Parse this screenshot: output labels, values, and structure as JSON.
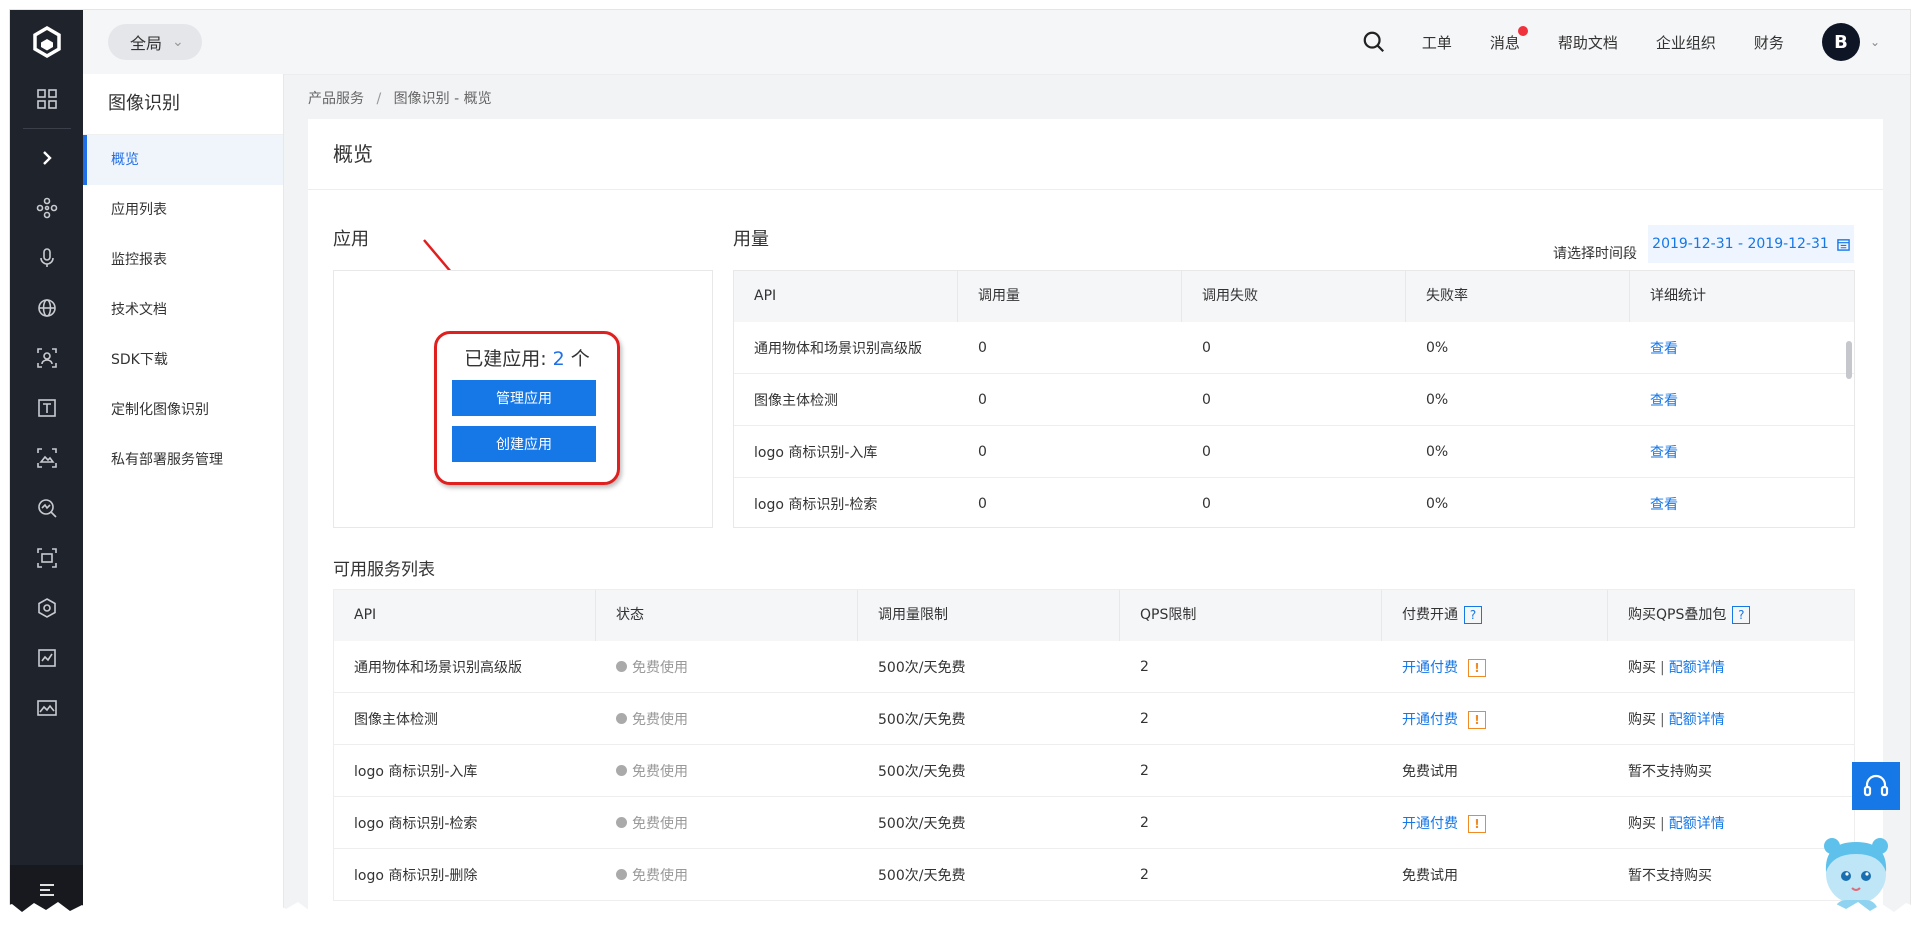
{
  "header": {
    "scope_label": "全局",
    "nav": [
      "工单",
      "消息",
      "帮助文档",
      "企业组织",
      "财务"
    ],
    "avatar_letter": "B"
  },
  "sidenav": {
    "title": "图像识别",
    "items": [
      "概览",
      "应用列表",
      "监控报表",
      "技术文档",
      "SDK下载",
      "定制化图像识别",
      "私有部署服务管理"
    ]
  },
  "breadcrumb": {
    "root": "产品服务",
    "sep": "/",
    "current": "图像识别 - 概览"
  },
  "page_title": "概览",
  "apps": {
    "title": "应用",
    "count_label": "已建应用:",
    "count": "2",
    "count_unit": "个",
    "manage_button": "管理应用",
    "create_button": "创建应用"
  },
  "usage": {
    "title": "用量",
    "date_label": "请选择时间段",
    "date_range": "2019-12-31 - 2019-12-31",
    "columns": [
      "API",
      "调用量",
      "调用失败",
      "失败率",
      "详细统计"
    ],
    "rows": [
      {
        "api": "通用物体和场景识别高级版",
        "calls": "0",
        "fails": "0",
        "rate": "0%",
        "action": "查看"
      },
      {
        "api": "图像主体检测",
        "calls": "0",
        "fails": "0",
        "rate": "0%",
        "action": "查看"
      },
      {
        "api": "logo 商标识别-入库",
        "calls": "0",
        "fails": "0",
        "rate": "0%",
        "action": "查看"
      },
      {
        "api": "logo 商标识别-检索",
        "calls": "0",
        "fails": "0",
        "rate": "0%",
        "action": "查看"
      }
    ]
  },
  "services": {
    "title": "可用服务列表",
    "columns": [
      "API",
      "状态",
      "调用量限制",
      "QPS限制",
      "付费开通",
      "购买QPS叠加包"
    ],
    "help_glyph": "?",
    "warn_glyph": "!",
    "rows": [
      {
        "api": "通用物体和场景识别高级版",
        "status": "免费使用",
        "limit": "500次/天免费",
        "qps": "2",
        "pay": "开通付费",
        "pay_link": true,
        "buy": "购买",
        "detail": "配额详情"
      },
      {
        "api": "图像主体检测",
        "status": "免费使用",
        "limit": "500次/天免费",
        "qps": "2",
        "pay": "开通付费",
        "pay_link": true,
        "buy": "购买",
        "detail": "配额详情"
      },
      {
        "api": "logo 商标识别-入库",
        "status": "免费使用",
        "limit": "500次/天免费",
        "qps": "2",
        "pay": "免费试用",
        "pay_link": false,
        "buy": "暂不支持购买",
        "detail": ""
      },
      {
        "api": "logo 商标识别-检索",
        "status": "免费使用",
        "limit": "500次/天免费",
        "qps": "2",
        "pay": "开通付费",
        "pay_link": true,
        "buy": "购买",
        "detail": "配额详情"
      },
      {
        "api": "logo 商标识别-删除",
        "status": "免费使用",
        "limit": "500次/天免费",
        "qps": "2",
        "pay": "免费试用",
        "pay_link": false,
        "buy": "暂不支持购买",
        "detail": ""
      }
    ]
  },
  "colors": {
    "primary": "#1677e6",
    "rail_bg": "#1f232b",
    "annotation_red": "#e01f1f",
    "warn": "#f08a24"
  }
}
